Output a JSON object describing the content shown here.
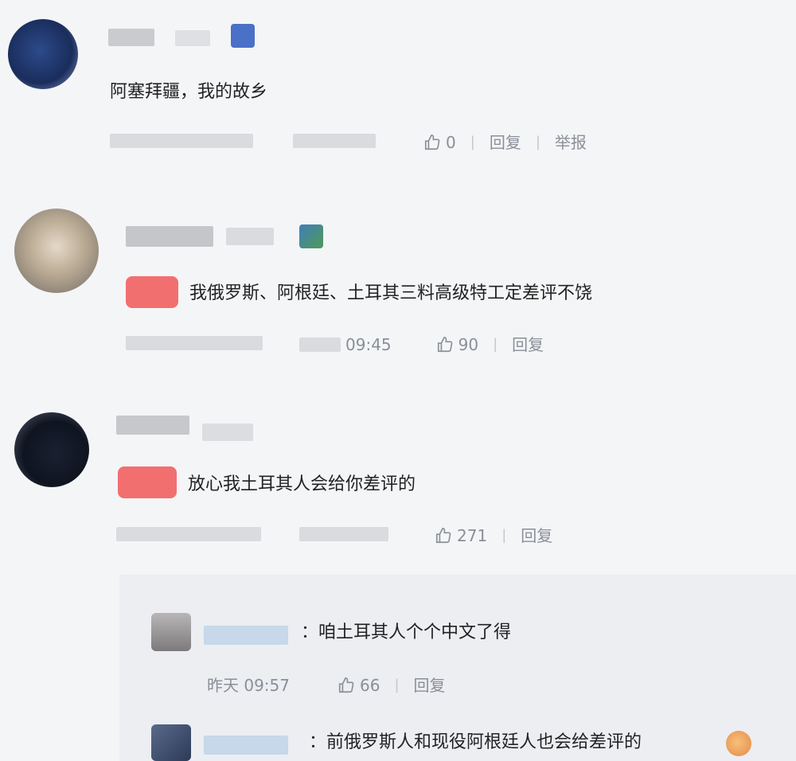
{
  "comments": [
    {
      "text": "阿塞拜疆，我的故乡",
      "time": "",
      "likes": "0",
      "reply": "回复",
      "report": "举报"
    },
    {
      "text": "我俄罗斯、阿根廷、土耳其三料高级特工定差评不饶",
      "time": "09:45",
      "likes": "90",
      "reply": "回复"
    },
    {
      "text": "放心我土耳其人会给你差评的",
      "time": "",
      "likes": "271",
      "reply": "回复"
    }
  ],
  "replies": [
    {
      "text": "：咱土耳其人个个中文了得",
      "time": "昨天 09:57",
      "likes": "66",
      "reply": "回复"
    },
    {
      "text": "：前俄罗斯人和现役阿根廷人也会给差评的"
    }
  ],
  "colors": {
    "background": "#f4f5f7",
    "badge": "#f26060",
    "meta_text": "#8a8f98",
    "reply_background": "#eceef2"
  },
  "icons": [
    "thumbs-up-icon",
    "vip-badge-icon"
  ]
}
